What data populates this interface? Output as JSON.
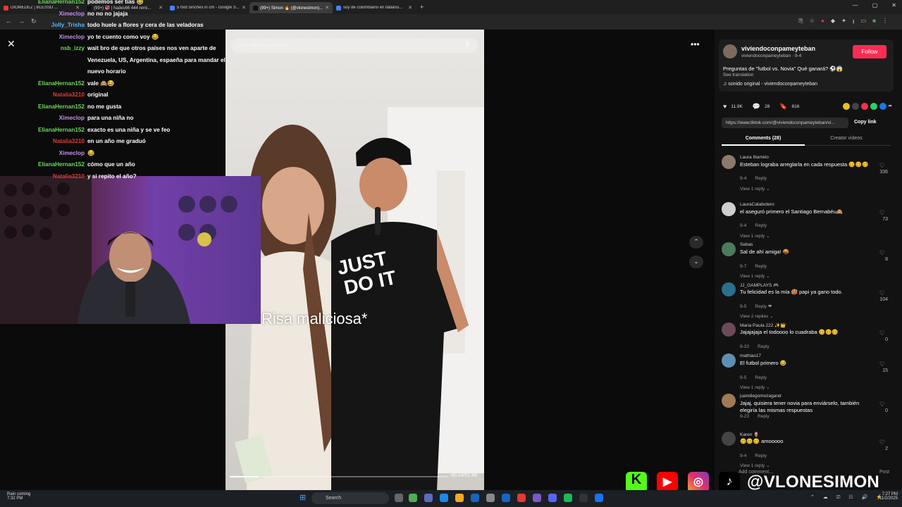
{
  "browser": {
    "tabs": [
      {
        "label": "DIOMEDEZ | BLESSD ...",
        "color": "#e53935",
        "active": false
      },
      {
        "label": "(99+) 💞 | hades66 444 remi...",
        "color": "#111111",
        "active": false
      },
      {
        "label": "5 foot 5inches in cm - Google S...",
        "color": "#4285f4",
        "active": false
      },
      {
        "label": "(99+) Simon 🔥 (@vlonesimon)...",
        "color": "#111111",
        "active": true
      },
      {
        "label": "soy de colombiano en italiano...",
        "color": "#4285f4",
        "active": false
      }
    ],
    "new_tab": "+",
    "window_controls": [
      "—",
      "▢",
      "✕"
    ]
  },
  "chat": {
    "messages": [
      {
        "user": "ElianaHernan152",
        "text": "podemos ser tías 😂",
        "color": "g"
      },
      {
        "user": "Ximeclop",
        "text": "no no no jajaja",
        "color": "p"
      },
      {
        "user": "Jolly_Trisha",
        "text": "todo huele a flores y cera de las veladoras",
        "color": "b"
      },
      {
        "user": "Ximeclop",
        "text": "yo te cuento como voy 😂",
        "color": "p"
      },
      {
        "user": "nsb_izzy",
        "text": "wait bro de que otros países nos ven aparte de",
        "color": "g"
      },
      {
        "user": "",
        "text": "Venezuela, US, Argentina, espaeña para mandar el",
        "color": "g"
      },
      {
        "user": "",
        "text": "nuevo horario",
        "color": "g"
      },
      {
        "user": "ElianaHernan152",
        "text": "vale 🙈😂",
        "color": "g"
      },
      {
        "user": "Natalia3210",
        "text": "original",
        "color": "r"
      },
      {
        "user": "ElianaHernan152",
        "text": "no me gusta",
        "color": "g"
      },
      {
        "user": "Ximeclop",
        "text": "para una niña no",
        "color": "p"
      },
      {
        "user": "ElianaHernan152",
        "text": "exacto es una niña y se ve feo",
        "color": "g"
      },
      {
        "user": "Natalia3210",
        "text": "en un año me graduó",
        "color": "r"
      },
      {
        "user": "Ximeclop",
        "text": "😂",
        "color": "p"
      },
      {
        "user": "ElianaHernan152",
        "text": "cómo que un año",
        "color": "g"
      },
      {
        "user": "Natalia3210",
        "text": "y si repito el año?",
        "color": "r"
      }
    ]
  },
  "video": {
    "search_placeholder": "Find related content",
    "caption": "Risa maliciosa*",
    "timecode": "00:14/01:45",
    "progress": 0.13
  },
  "post": {
    "username": "viviendoconpameyteban",
    "subline": "viviendoconpameyteban · 9-4",
    "follow_label": "Follow",
    "description": "Preguntas de \"futbol vs. Novia\" Qué ganará? ⚽😱",
    "see_translation": "See translation",
    "sound": "♫  sonido original - viviendoconpameyteban",
    "likes": "11.9K",
    "comments": "28",
    "saves": "816",
    "url": "https://www.tiktok.com/@viviendoconpameyteban/vi...",
    "copy_link": "Copy link",
    "tab_comments": "Comments (28)",
    "tab_creator": "Creator videos"
  },
  "comments": [
    {
      "user": "Laura Ibarreto",
      "text": "Esteban lograba arreglarla en cada respuesta 🥴🥴🥴",
      "date": "9-4",
      "reply": "Reply",
      "view": "View 1 reply ⌄",
      "likes": "336",
      "avatar": "#8a7a6a"
    },
    {
      "user": "LauraCatabotero",
      "text": "el aseguró primero el Santiago Bernabéu🙈",
      "date": "9-4",
      "reply": "Reply",
      "view": "View 1 reply ⌄",
      "likes": "73",
      "avatar": "#cfcfcf"
    },
    {
      "user": "Sebas",
      "text": "Sal de ahí amiga! 🤬",
      "date": "9-7",
      "reply": "Reply",
      "view": "View 1 reply ⌄",
      "likes": "8",
      "avatar": "#4d7a5a"
    },
    {
      "user": "JJ_GAMPLAYS 🎮",
      "text": "Tu felicidad es la mía 🥵 papi ya gano todo.",
      "date": "9-5",
      "reply": "Reply ❤",
      "view": "View 2 replies ⌄",
      "likes": "104",
      "avatar": "#2b6f8a"
    },
    {
      "user": "Maria Paula 222 ✨👑",
      "text": "Jajajajaja el todoooo lo cuadraba 🥴🥴🥴",
      "date": "9-10",
      "reply": "Reply",
      "view": "",
      "likes": "0",
      "avatar": "#6b4a5a"
    },
    {
      "user": "mathias17",
      "text": "El futbol primero 😂",
      "date": "9-5",
      "reply": "Reply",
      "view": "View 1 reply ⌄",
      "likes": "15",
      "avatar": "#5f8fb0"
    },
    {
      "user": "juandiegomozagand",
      "text": "Jajaj, quisiera tener novia para enviárselo, también elegiría las mismas respuestas",
      "date": "9-23",
      "reply": "Reply",
      "view": "",
      "likes": "0",
      "avatar": "#a07a55"
    },
    {
      "user": "Karen 🌷",
      "text": "🥴🥴🥴 amooooo",
      "date": "9-4",
      "reply": "Reply",
      "view": "View 1 reply ⌄",
      "likes": "2",
      "avatar": "#444444"
    }
  ],
  "post_bar": {
    "placeholder": "Add comment...",
    "post": "Post"
  },
  "overlay": {
    "handle": "@VLONESIMON"
  },
  "taskbar": {
    "weather_line1": "Rain coming",
    "weather_line2": "7:32 PM",
    "search": "Search",
    "time": "7:27 PM",
    "date": "11/2/2025"
  }
}
